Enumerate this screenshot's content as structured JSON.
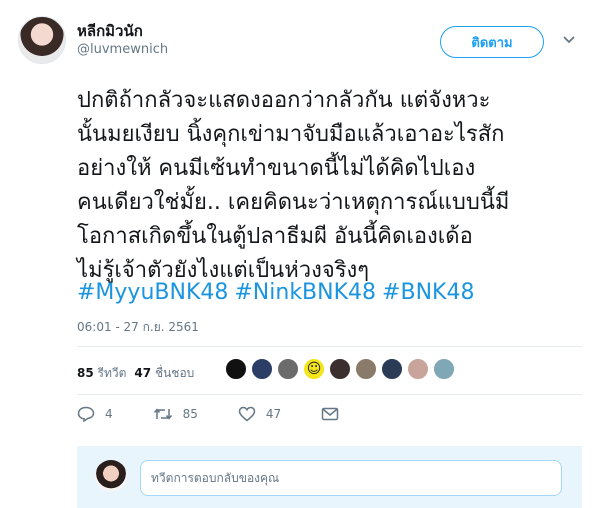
{
  "author": {
    "display_name": "หลีกมิวนัก",
    "handle": "@luvmewnich"
  },
  "follow_label": "ติดตาม",
  "tweet": {
    "text": "ปกติถ้ากลัวจะแสดงออกว่ากลัวกัน แต่จังหวะ\nนั้นมยเงียบ นิ้งคุกเข่ามาจับมือแล้วเอาอะไรสัก\nอย่างให้ คนมีเซ้นทำขนาดนี้ไม่ได้คิดไปเอง\nคนเดียวใช่มั้ย.. เคยคิดนะว่าเหตุการณ์แบบนี้มี\nโอกาสเกิดขึ้นในตู้ปลาธีมผี อันนี้คิดเองเด้อ\nไม่รู้เจ้าตัวยังไงแต่เป็นห่วงจริงๆ",
    "hashtags": [
      "#MyyuBNK48",
      "#NinkBNK48",
      "#BNK48"
    ],
    "timestamp": "06:01 - 27 ก.ย. 2561"
  },
  "stats": {
    "retweet_count": "85",
    "retweet_label": "รีทวีต",
    "like_count": "47",
    "like_label": "ชื่นชอบ"
  },
  "likers": [
    {
      "icon": "liker-avatar-1",
      "color": "#111111"
    },
    {
      "icon": "liker-avatar-2",
      "color": "#2c3e66"
    },
    {
      "icon": "liker-avatar-3",
      "color": "#6b6b6b"
    },
    {
      "icon": "liker-avatar-smiley",
      "color": "#f5e51b"
    },
    {
      "icon": "liker-avatar-5",
      "color": "#3b2f2f"
    },
    {
      "icon": "liker-avatar-6",
      "color": "#8a7a6a"
    },
    {
      "icon": "liker-avatar-7",
      "color": "#2b3a55"
    },
    {
      "icon": "liker-avatar-8",
      "color": "#c9a49a"
    },
    {
      "icon": "liker-avatar-9",
      "color": "#7fa7b5"
    }
  ],
  "actions": {
    "reply_count": "4",
    "retweet_count": "85",
    "like_count": "47"
  },
  "reply": {
    "placeholder": "ทวีตการตอบกลับของคุณ"
  },
  "colors": {
    "accent": "#1da1f2",
    "hashtag": "#1b95e0",
    "muted": "#657786"
  }
}
